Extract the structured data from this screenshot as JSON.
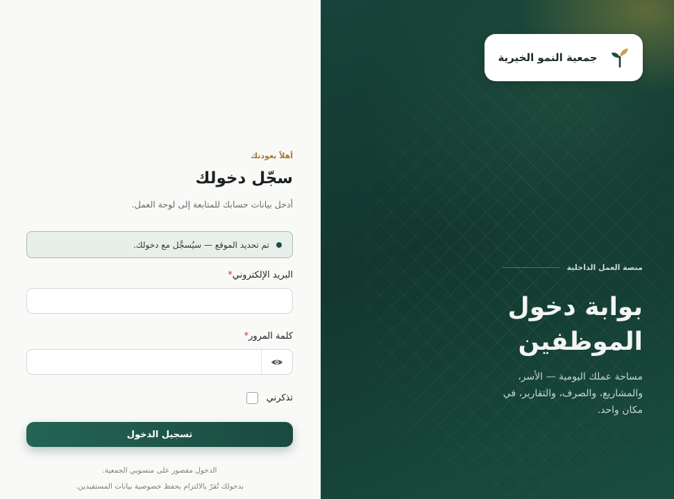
{
  "brand": {
    "org_name": "جمعية النمو الخيرية",
    "logo_icon": "sprout-icon",
    "eyebrow": "منصة العمل الداخلية",
    "hero_title_line1": "بوابة دخول",
    "hero_title_line2": "الموظفين",
    "hero_desc": "مساحة عملك اليومية — الأسر، والمشاريع، والصرف، والتقارير، في مكان واحد.",
    "colors": {
      "panel": "#17443a",
      "accent_gold": "#a37a2c",
      "leaf_green": "#1d4d3e",
      "leaf_gold": "#c9a24a"
    }
  },
  "login": {
    "welcome": "أهلاً بعودتك",
    "title": "سجّل دخولك",
    "subtitle": "أدخل بيانات حسابك للمتابعة إلى لوحة العمل.",
    "notice": "تم تحديد الموقع — سيُسجَّل مع دخولك.",
    "email_label": "البريد الإلكتروني",
    "email_value": "",
    "password_label": "كلمة المرور",
    "password_value": "",
    "required_mark": "*",
    "show_password_icon": "eye-icon",
    "remember_label": "تذكرني",
    "remember_checked": false,
    "submit_label": "تسجيل الدخول",
    "footnote_1": "الدخول مقصور على منسوبي الجمعية.",
    "footnote_2": "بدخولك تُقرّ بالالتزام بحفظ خصوصية بيانات المستفيدين."
  }
}
